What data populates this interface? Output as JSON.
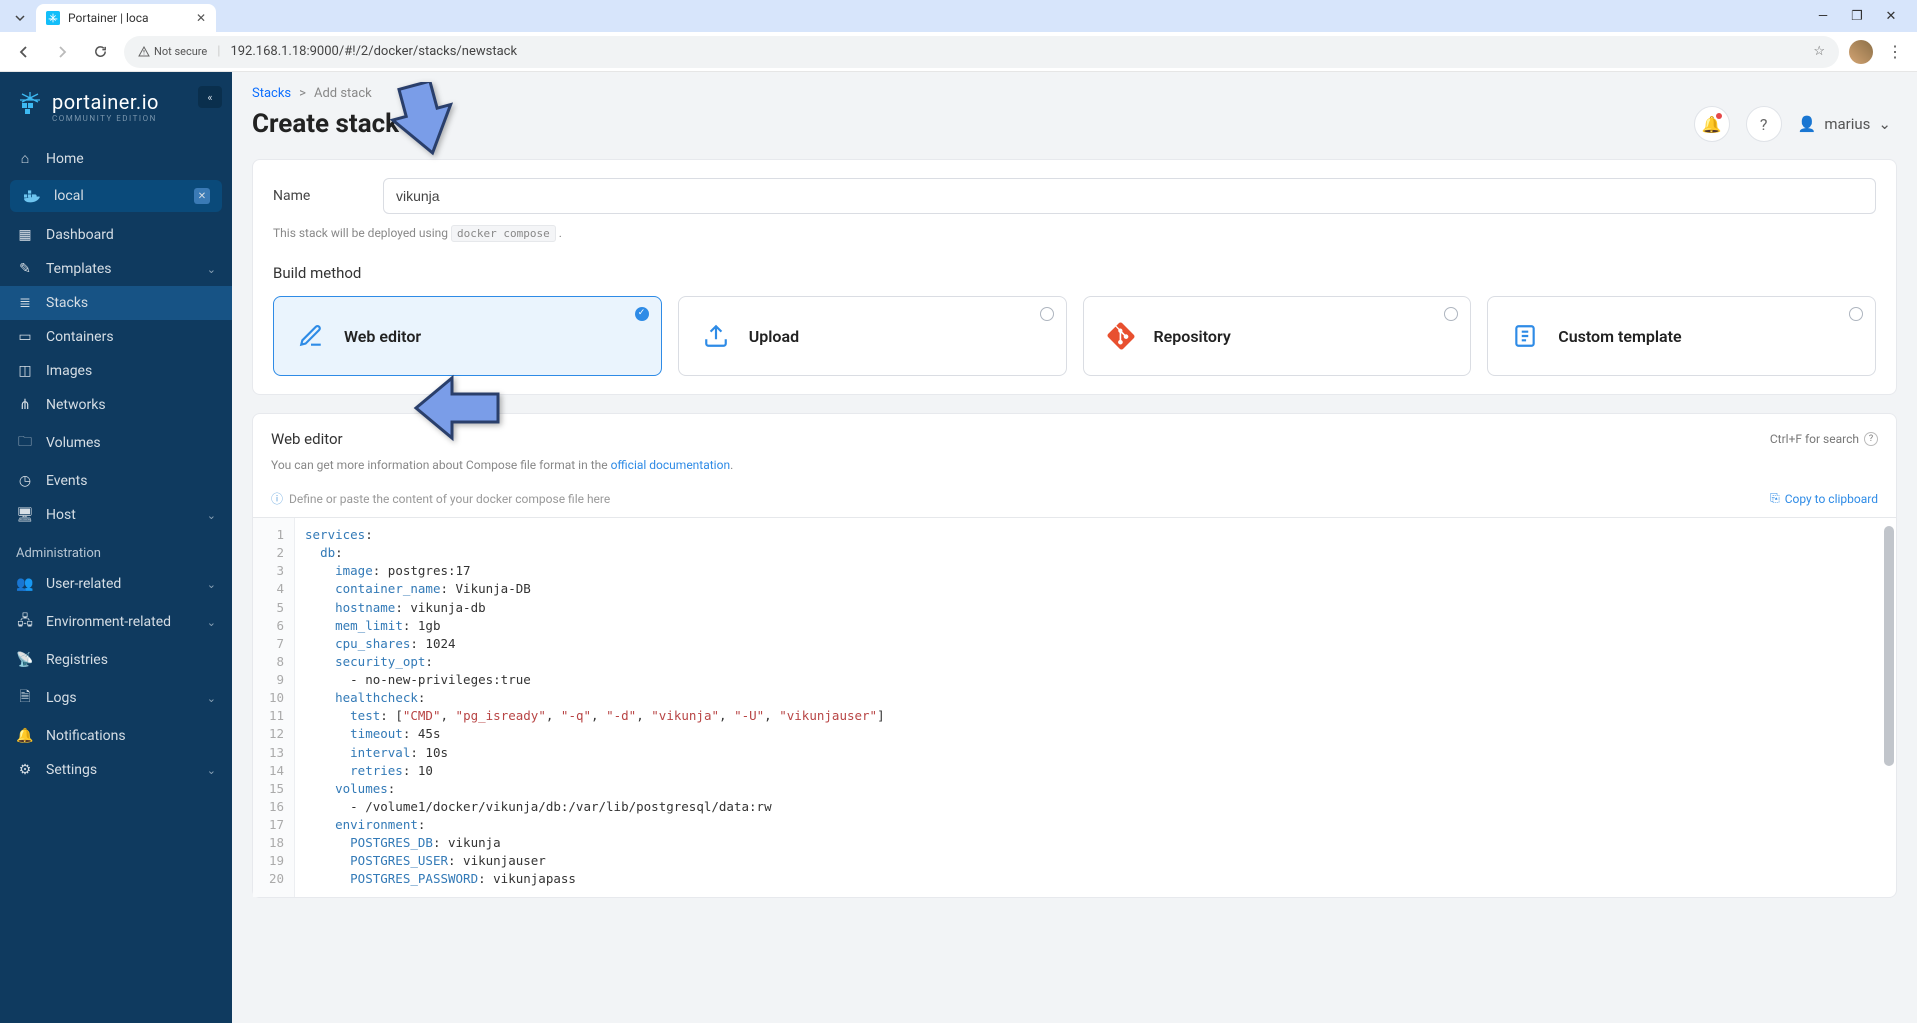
{
  "browser": {
    "tab_title": "Portainer | loca",
    "not_secure": "Not secure",
    "url": "192.168.1.18:9000/#!/2/docker/stacks/newstack"
  },
  "sidebar": {
    "brand": "portainer.io",
    "brand_sub": "COMMUNITY EDITION",
    "home": "Home",
    "env": "local",
    "items": {
      "dashboard": "Dashboard",
      "templates": "Templates",
      "stacks": "Stacks",
      "containers": "Containers",
      "images": "Images",
      "networks": "Networks",
      "volumes": "Volumes",
      "events": "Events",
      "host": "Host"
    },
    "admin_header": "Administration",
    "admin": {
      "user": "User-related",
      "env": "Environment-related",
      "registries": "Registries",
      "logs": "Logs",
      "notifications": "Notifications",
      "settings": "Settings"
    }
  },
  "breadcrumb": {
    "stacks": "Stacks",
    "add": "Add stack"
  },
  "page_title": "Create stack",
  "user": "marius",
  "form": {
    "name_label": "Name",
    "name_value": "vikunja",
    "hint_pre": "This stack will be deployed using ",
    "hint_code": "docker compose",
    "hint_post": " ."
  },
  "build_method": {
    "title": "Build method",
    "web": "Web editor",
    "upload": "Upload",
    "repo": "Repository",
    "custom": "Custom template"
  },
  "editor": {
    "title": "Web editor",
    "search": "Ctrl+F for search",
    "sub_pre": "You can get more information about Compose file format in the ",
    "sub_link": "official documentation",
    "sub_post": ".",
    "define": "Define or paste the content of your docker compose file here",
    "copy": "Copy to clipboard"
  },
  "chart_data": {
    "type": "table",
    "title": "docker-compose editor content",
    "lines": [
      "services:",
      "  db:",
      "    image: postgres:17",
      "    container_name: Vikunja-DB",
      "    hostname: vikunja-db",
      "    mem_limit: 1gb",
      "    cpu_shares: 1024",
      "    security_opt:",
      "      - no-new-privileges:true",
      "    healthcheck:",
      "      test: [\"CMD\", \"pg_isready\", \"-q\", \"-d\", \"vikunja\", \"-U\", \"vikunjauser\"]",
      "      timeout: 45s",
      "      interval: 10s",
      "      retries: 10",
      "    volumes:",
      "      - /volume1/docker/vikunja/db:/var/lib/postgresql/data:rw",
      "    environment:",
      "      POSTGRES_DB: vikunja",
      "      POSTGRES_USER: vikunjauser",
      "      POSTGRES_PASSWORD: vikunjapass"
    ]
  }
}
